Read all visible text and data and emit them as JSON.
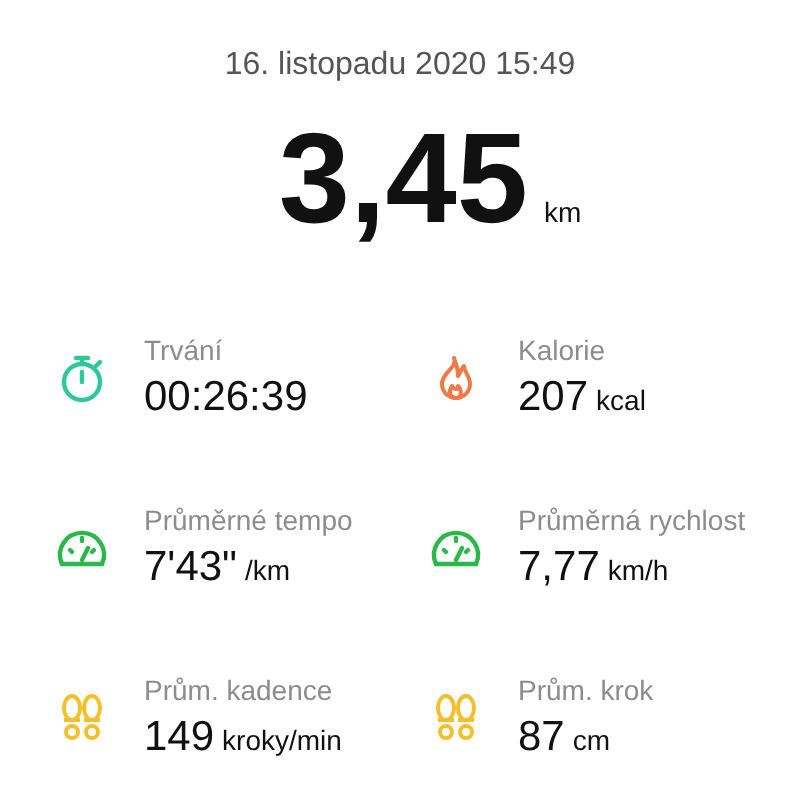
{
  "date": "16. listopadu 2020 15:49",
  "distance": {
    "value": "3,45",
    "unit": "km"
  },
  "stats": [
    {
      "kind": "stopwatch",
      "color": "#2ec99a",
      "label": "Trvání",
      "value": "00:26:39"
    },
    {
      "kind": "flame",
      "color": "#ee7a45",
      "label": "Kalorie",
      "value": "207",
      "unit": "kcal"
    },
    {
      "kind": "gauge",
      "color": "#2bb84a",
      "label": "Průměrné tempo",
      "value": "7'43\"",
      "unit": "/km"
    },
    {
      "kind": "gauge",
      "color": "#2bb84a",
      "label": "Průměrná rychlost",
      "value": "7,77",
      "unit": "km/h"
    },
    {
      "kind": "footprints",
      "color": "#f3c02b",
      "label": "Prům. kadence",
      "value": "149",
      "unit": "kroky/min"
    },
    {
      "kind": "footprints",
      "color": "#f3c02b",
      "label": "Prům. krok",
      "value": "87",
      "unit": "cm"
    }
  ]
}
